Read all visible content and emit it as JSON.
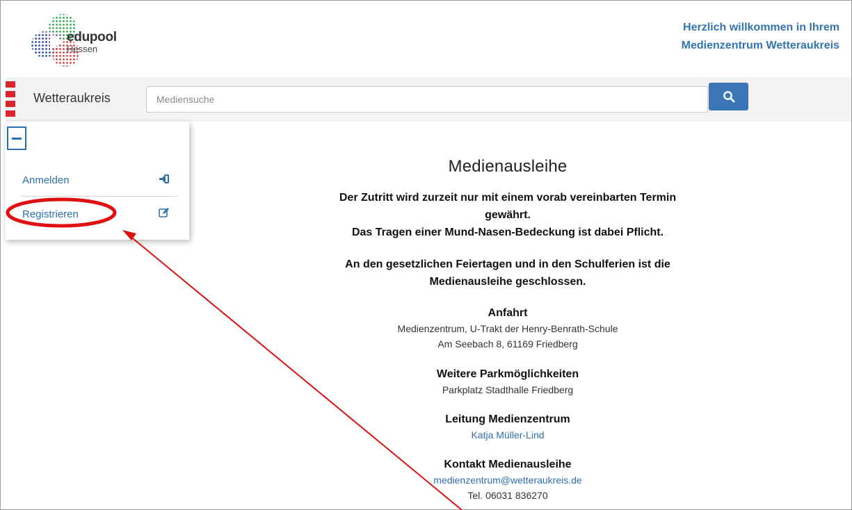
{
  "logo": {
    "name": "edupool",
    "sub": "Hessen"
  },
  "header": {
    "welcome_line1": "Herzlich willkommen in Ihrem",
    "welcome_line2": "Medienzentrum Wetteraukreis"
  },
  "navbar": {
    "brand": "Wetteraukreis",
    "search_placeholder": "Mediensuche",
    "search_icon": "search-icon"
  },
  "dropdown": {
    "items": [
      {
        "label": "Anmelden",
        "icon": "sign-in-icon"
      },
      {
        "label": "Registrieren",
        "icon": "edit-icon"
      }
    ]
  },
  "main": {
    "title": "Medienausleihe",
    "notice_line1": "Der Zutritt wird zurzeit nur mit einem vorab vereinbarten Termin",
    "notice_line2": "gewährt.",
    "notice_line3": "Das Tragen einer Mund-Nasen-Bedeckung ist dabei Pflicht.",
    "holiday_line1": "An den gesetzlichen Feiertagen und in den Schulferien ist die",
    "holiday_line2": "Medienausleihe geschlossen.",
    "sections": [
      {
        "heading": "Anfahrt",
        "lines": [
          "Medienzentrum, U-Trakt der Henry-Benrath-Schule",
          "Am Seebach 8, 61169 Friedberg"
        ]
      },
      {
        "heading": "Weitere Parkmöglichkeiten",
        "lines": [
          "Parkplatz Stadthalle Friedberg"
        ]
      },
      {
        "heading": "Leitung Medienzentrum",
        "link": "Katja Müller-Lind"
      },
      {
        "heading": "Kontakt Medienausleihe",
        "link": "medienzentrum@wetteraukreis.de",
        "lines": [
          "Tel. 06031 836270"
        ]
      }
    ]
  },
  "annotation": {
    "color": "#e01010"
  }
}
